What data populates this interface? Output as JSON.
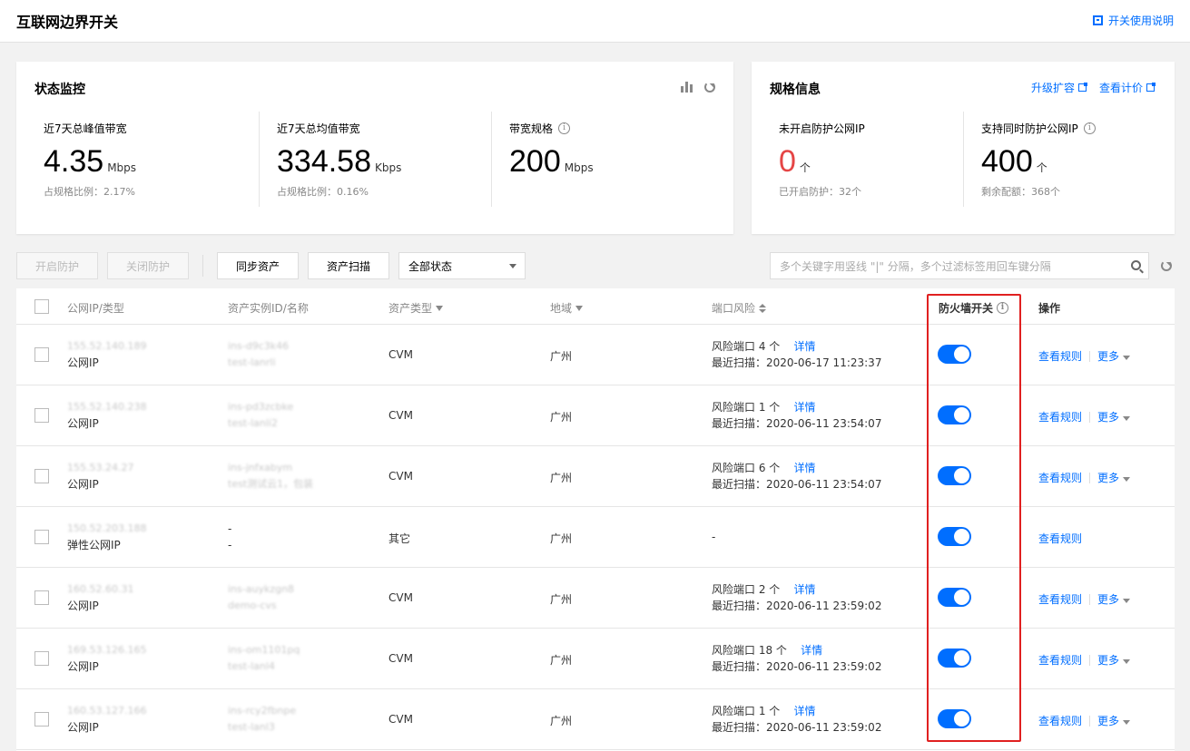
{
  "header": {
    "title": "互联网边界开关",
    "help_link": "开关使用说明"
  },
  "status_card": {
    "title": "状态监控",
    "metrics": [
      {
        "label": "近7天总峰值带宽",
        "value": "4.35",
        "unit": "Mbps",
        "sub": "占规格比例：2.17%"
      },
      {
        "label": "近7天总均值带宽",
        "value": "334.58",
        "unit": "Kbps",
        "sub": "占规格比例：0.16%"
      },
      {
        "label": "带宽规格",
        "value": "200",
        "unit": "Mbps",
        "sub": ""
      }
    ]
  },
  "spec_card": {
    "title": "规格信息",
    "links": [
      "升级扩容",
      "查看计价"
    ],
    "metrics": [
      {
        "label": "未开启防护公网IP",
        "value": "0",
        "unit": "个",
        "sub": "已开启防护：32个"
      },
      {
        "label": "支持同时防护公网IP",
        "value": "400",
        "unit": "个",
        "sub": "剩余配额：368个"
      }
    ]
  },
  "toolbar": {
    "enable": "开启防护",
    "disable": "关闭防护",
    "sync": "同步资产",
    "scan": "资产扫描",
    "status_select": "全部状态",
    "search_placeholder": "多个关键字用竖线 \"|\" 分隔，多个过滤标签用回车键分隔"
  },
  "table": {
    "columns": [
      "公网IP/类型",
      "资产实例ID/名称",
      "资产类型",
      "地域",
      "端口风险",
      "防火墙开关",
      "操作"
    ],
    "rows": [
      {
        "ip": "155.52.140.189",
        "ip_type": "公网IP",
        "inst_id": "ins-d9c3k46",
        "inst_name": "test-lanrli",
        "asset_type": "CVM",
        "region": "广州",
        "risk": "风险端口 4 个",
        "scan": "最近扫描：2020-06-17 11:23:37",
        "detail": "详情",
        "view": "查看规则",
        "more": "更多"
      },
      {
        "ip": "155.52.140.238",
        "ip_type": "公网IP",
        "inst_id": "ins-pd3zcbke",
        "inst_name": "test-lanli2",
        "asset_type": "CVM",
        "region": "广州",
        "risk": "风险端口 1 个",
        "scan": "最近扫描：2020-06-11 23:54:07",
        "detail": "详情",
        "view": "查看规则",
        "more": "更多"
      },
      {
        "ip": "155.53.24.27",
        "ip_type": "公网IP",
        "inst_id": "ins-jnfxabym",
        "inst_name": "test测试云1，包装",
        "asset_type": "CVM",
        "region": "广州",
        "risk": "风险端口 6 个",
        "scan": "最近扫描：2020-06-11 23:54:07",
        "detail": "详情",
        "view": "查看规则",
        "more": "更多"
      },
      {
        "ip": "150.52.203.188",
        "ip_type": "弹性公网IP",
        "inst_id": "-",
        "inst_name": "-",
        "asset_type": "其它",
        "region": "广州",
        "risk": "-",
        "scan": "",
        "detail": "",
        "view": "查看规则",
        "more": ""
      },
      {
        "ip": "160.52.60.31",
        "ip_type": "公网IP",
        "inst_id": "ins-auykzgn8",
        "inst_name": "demo-cvs",
        "asset_type": "CVM",
        "region": "广州",
        "risk": "风险端口 2 个",
        "scan": "最近扫描：2020-06-11 23:59:02",
        "detail": "详情",
        "view": "查看规则",
        "more": "更多"
      },
      {
        "ip": "169.53.126.165",
        "ip_type": "公网IP",
        "inst_id": "ins-om1101pq",
        "inst_name": "test-lanl4",
        "asset_type": "CVM",
        "region": "广州",
        "risk": "风险端口 18 个",
        "scan": "最近扫描：2020-06-11 23:59:02",
        "detail": "详情",
        "view": "查看规则",
        "more": "更多"
      },
      {
        "ip": "160.53.127.166",
        "ip_type": "公网IP",
        "inst_id": "ins-rcy2fbnpe",
        "inst_name": "test-lanl3",
        "asset_type": "CVM",
        "region": "广州",
        "risk": "风险端口 1 个",
        "scan": "最近扫描：2020-06-11 23:59:02",
        "detail": "详情",
        "view": "查看规则",
        "more": "更多"
      }
    ]
  },
  "colors": {
    "accent": "#006eff",
    "danger": "#e54545",
    "highlight_box": "#e02020"
  }
}
